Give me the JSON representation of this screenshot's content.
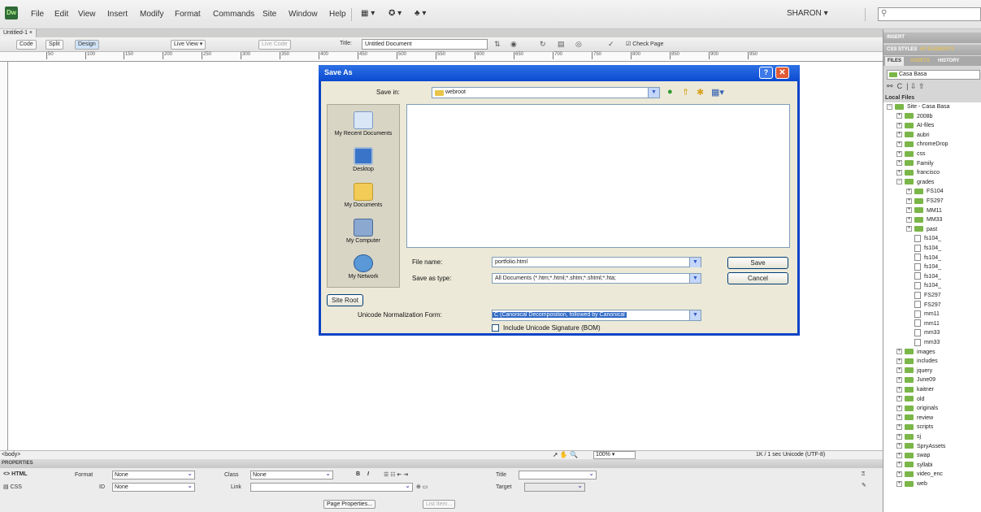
{
  "app": {
    "logo_text": "Dw",
    "menu": [
      "File",
      "Edit",
      "View",
      "Insert",
      "Modify",
      "Format",
      "Commands",
      "Site",
      "Window",
      "Help"
    ],
    "toolbar_icons": [
      "layout-icon",
      "extend-icon",
      "site-icon"
    ],
    "workspace": "SHARON",
    "search_placeholder": ""
  },
  "document": {
    "tab_label": "Untitled-1",
    "view_buttons": [
      "Code",
      "Split",
      "Design"
    ],
    "live_view_label": "Live View",
    "live_code_label": "Live Code",
    "title_label": "Title:",
    "title_value": "Untitled Document",
    "check_page_label": "Check Page",
    "ruler_ticks": [
      "50",
      "100",
      "150",
      "200",
      "250",
      "300",
      "350",
      "400",
      "450",
      "500",
      "550",
      "600",
      "650",
      "700",
      "750",
      "800",
      "850",
      "900",
      "950"
    ]
  },
  "status_bar": {
    "tag_selector": "<body>",
    "zoom": "100%",
    "info": "1K / 1 sec  Unicode (UTF-8)"
  },
  "properties": {
    "header": "PROPERTIES",
    "html_label": "HTML",
    "css_label": "CSS",
    "format_label": "Format",
    "format_value": "None",
    "id_label": "ID",
    "id_value": "None",
    "class_label": "Class",
    "class_value": "None",
    "link_label": "Link",
    "link_value": "",
    "title_label": "Title",
    "target_label": "Target",
    "page_properties_label": "Page Properties...",
    "list_item_label": "List Item..."
  },
  "dock": {
    "insert_header": "INSERT",
    "css_header": "CSS STYLES",
    "ap_header": "AP ELEMENTS",
    "tabs": [
      "FILES",
      "ASSETS",
      "HISTORY"
    ],
    "site_name": "Casa Basa",
    "local_files_label": "Local Files",
    "tree": [
      {
        "label": "Site - Casa Basa",
        "kind": "folder",
        "depth": 0,
        "exp": "−"
      },
      {
        "label": "2008b",
        "kind": "folder",
        "depth": 1,
        "exp": "+"
      },
      {
        "label": "AI-files",
        "kind": "folder",
        "depth": 1,
        "exp": "+"
      },
      {
        "label": "aubri",
        "kind": "folder",
        "depth": 1,
        "exp": "+"
      },
      {
        "label": "chromeDrop",
        "kind": "folder",
        "depth": 1,
        "exp": "+"
      },
      {
        "label": "css",
        "kind": "folder",
        "depth": 1,
        "exp": "+"
      },
      {
        "label": "Family",
        "kind": "folder",
        "depth": 1,
        "exp": "+"
      },
      {
        "label": "francisco",
        "kind": "folder",
        "depth": 1,
        "exp": "+"
      },
      {
        "label": "grades",
        "kind": "folder",
        "depth": 1,
        "exp": "−"
      },
      {
        "label": "FS104",
        "kind": "folder",
        "depth": 2,
        "exp": "+"
      },
      {
        "label": "FS297",
        "kind": "folder",
        "depth": 2,
        "exp": "+"
      },
      {
        "label": "MM11",
        "kind": "folder",
        "depth": 2,
        "exp": "+"
      },
      {
        "label": "MM33",
        "kind": "folder",
        "depth": 2,
        "exp": "+"
      },
      {
        "label": "past",
        "kind": "folder",
        "depth": 2,
        "exp": "+"
      },
      {
        "label": "fs104_",
        "kind": "file",
        "depth": 2,
        "exp": ""
      },
      {
        "label": "fs104_",
        "kind": "file",
        "depth": 2,
        "exp": ""
      },
      {
        "label": "fs104_",
        "kind": "file",
        "depth": 2,
        "exp": ""
      },
      {
        "label": "fs104_",
        "kind": "file",
        "depth": 2,
        "exp": ""
      },
      {
        "label": "fs104_",
        "kind": "file",
        "depth": 2,
        "exp": ""
      },
      {
        "label": "fs104_",
        "kind": "file",
        "depth": 2,
        "exp": ""
      },
      {
        "label": "FS297",
        "kind": "file",
        "depth": 2,
        "exp": ""
      },
      {
        "label": "FS297",
        "kind": "file",
        "depth": 2,
        "exp": ""
      },
      {
        "label": "mm11",
        "kind": "file",
        "depth": 2,
        "exp": ""
      },
      {
        "label": "mm11",
        "kind": "file",
        "depth": 2,
        "exp": ""
      },
      {
        "label": "mm33",
        "kind": "file",
        "depth": 2,
        "exp": ""
      },
      {
        "label": "mm33",
        "kind": "file",
        "depth": 2,
        "exp": ""
      },
      {
        "label": "images",
        "kind": "folder",
        "depth": 1,
        "exp": "+"
      },
      {
        "label": "includes",
        "kind": "folder",
        "depth": 1,
        "exp": "+"
      },
      {
        "label": "jquery",
        "kind": "folder",
        "depth": 1,
        "exp": "+"
      },
      {
        "label": "June09",
        "kind": "folder",
        "depth": 1,
        "exp": "+"
      },
      {
        "label": "kaitner",
        "kind": "folder",
        "depth": 1,
        "exp": "+"
      },
      {
        "label": "old",
        "kind": "folder",
        "depth": 1,
        "exp": "+"
      },
      {
        "label": "originals",
        "kind": "folder",
        "depth": 1,
        "exp": "+"
      },
      {
        "label": "review",
        "kind": "folder",
        "depth": 1,
        "exp": "+"
      },
      {
        "label": "scripts",
        "kind": "folder",
        "depth": 1,
        "exp": "+"
      },
      {
        "label": "sj",
        "kind": "folder",
        "depth": 1,
        "exp": "+"
      },
      {
        "label": "SpryAssets",
        "kind": "folder",
        "depth": 1,
        "exp": "+"
      },
      {
        "label": "swap",
        "kind": "folder",
        "depth": 1,
        "exp": "+"
      },
      {
        "label": "syllabi",
        "kind": "folder",
        "depth": 1,
        "exp": "+"
      },
      {
        "label": "video_enc",
        "kind": "folder",
        "depth": 1,
        "exp": "+"
      },
      {
        "label": "web",
        "kind": "folder",
        "depth": 1,
        "exp": "+"
      }
    ]
  },
  "dialog": {
    "title": "Save As",
    "save_in_label": "Save in:",
    "save_in_value": "webroot",
    "places": [
      "My Recent Documents",
      "Desktop",
      "My Documents",
      "My Computer",
      "My Network"
    ],
    "file_name_label": "File name:",
    "file_name_value": "portfolio.html",
    "save_type_label": "Save as type:",
    "save_type_value": "All Documents (*.htm;*.html;*.shtm;*.shtml;*.hta;",
    "save_button": "Save",
    "cancel_button": "Cancel",
    "site_root_button": "Site Root",
    "unicode_label": "Unicode Normalization Form:",
    "unicode_value": "C (Canonical Decomposition, followed by Canonical",
    "bom_label": "Include Unicode Signature (BOM)",
    "bom_checked": false
  }
}
